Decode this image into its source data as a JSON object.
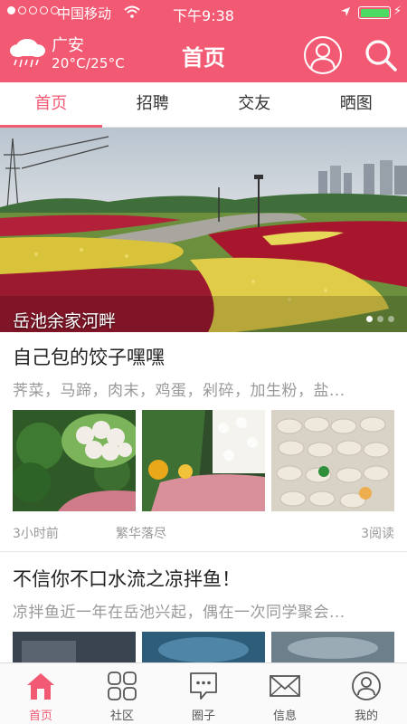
{
  "status_bar": {
    "carrier": "中国移动",
    "time": "下午9:38"
  },
  "header": {
    "weather": {
      "city": "广安",
      "temperature": "20°C/25°C",
      "icon": "rain-cloud-icon"
    },
    "title": "首页",
    "profile_icon": "user-icon",
    "search_icon": "search-icon"
  },
  "tabs": [
    {
      "label": "首页",
      "active": true
    },
    {
      "label": "招聘",
      "active": false
    },
    {
      "label": "交友",
      "active": false
    },
    {
      "label": "晒图",
      "active": false
    }
  ],
  "banner": {
    "caption": "岳池余家河畔",
    "slide_count": 3,
    "active_slide": 1
  },
  "posts": [
    {
      "title": "自己包的饺子嘿嘿",
      "excerpt": "荠菜，马蹄，肉末，鸡蛋，剁碎，加生粉，盐...",
      "time_ago": "3小时前",
      "author": "繁华落尽",
      "reads": "3阅读"
    },
    {
      "title": "不信你不口水流之凉拌鱼！",
      "excerpt": "凉拌鱼近一年在岳池兴起，偶在一次同学聚会..."
    }
  ],
  "bottom_nav": [
    {
      "label": "首页",
      "icon": "home-icon",
      "active": true
    },
    {
      "label": "社区",
      "icon": "grid-icon",
      "active": false
    },
    {
      "label": "圈子",
      "icon": "chat-bubble-icon",
      "active": false
    },
    {
      "label": "信息",
      "icon": "mail-icon",
      "active": false
    },
    {
      "label": "我的",
      "icon": "user-icon",
      "active": false
    }
  ],
  "colors": {
    "brand": "#f25a74",
    "text": "#222222",
    "muted": "#999999"
  }
}
